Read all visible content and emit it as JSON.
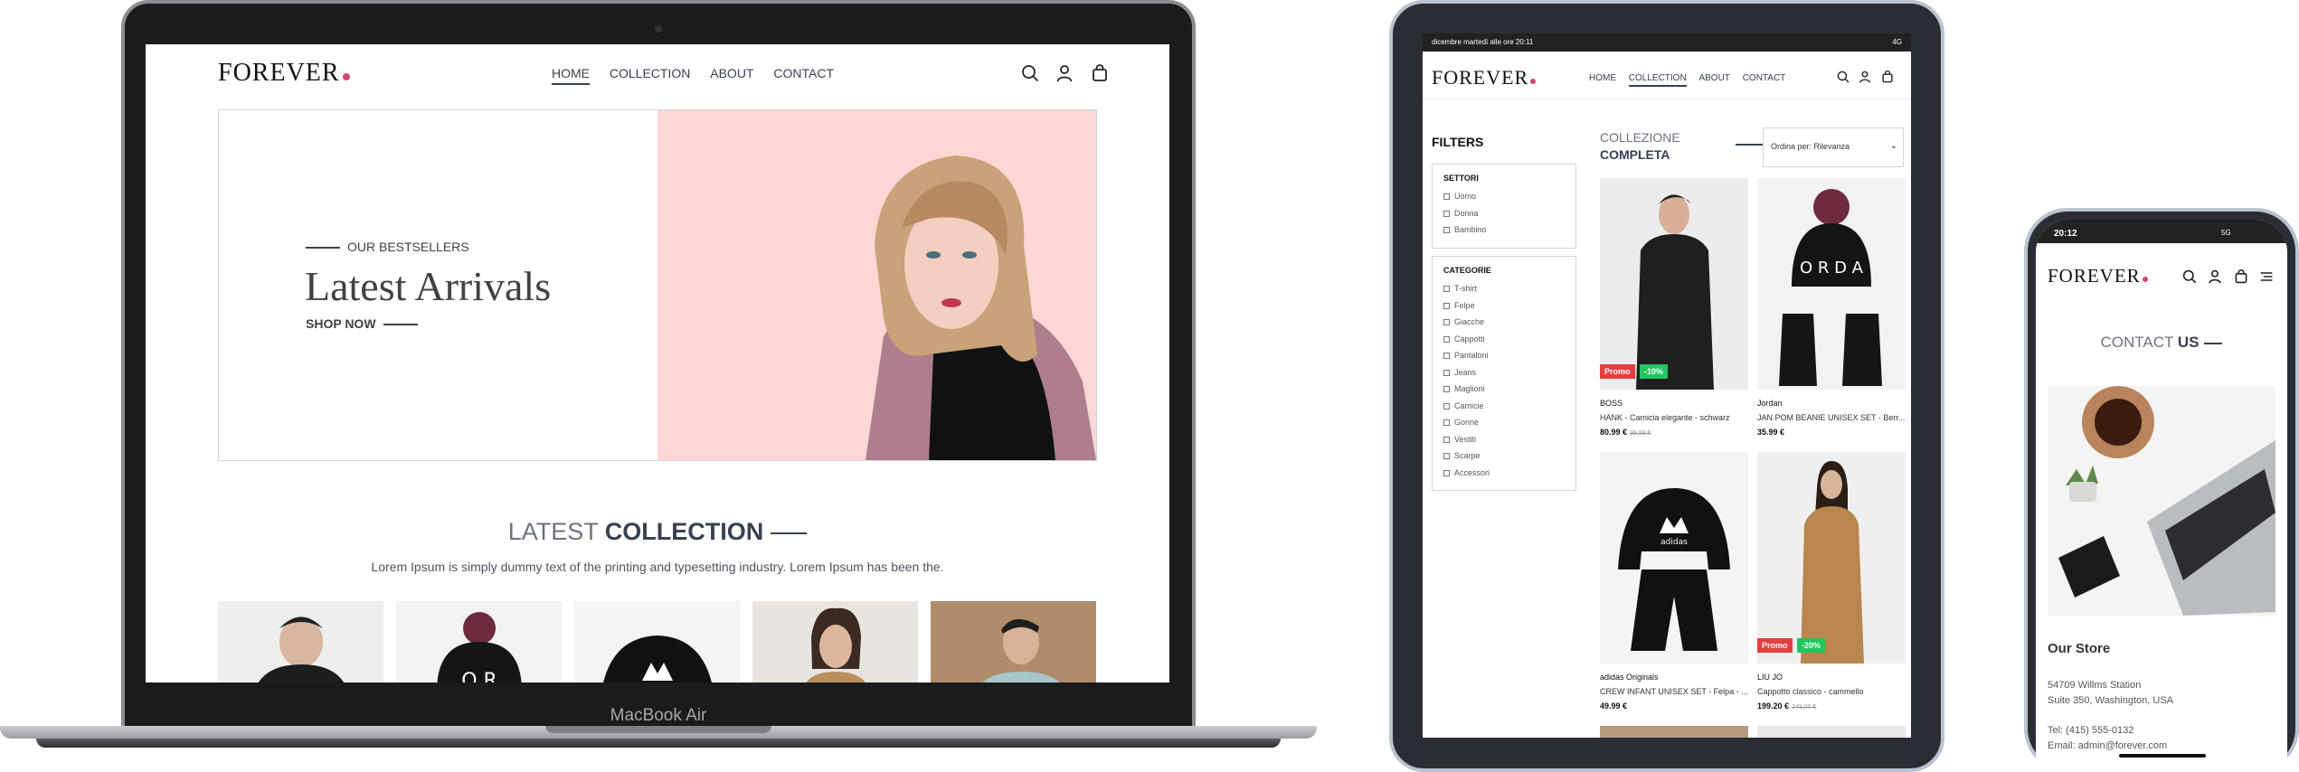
{
  "laptop": {
    "brand_label": "MacBook Air",
    "logo": "FOREVER",
    "nav": [
      "HOME",
      "COLLECTION",
      "ABOUT",
      "CONTACT"
    ],
    "icons": [
      "search-icon",
      "user-icon",
      "bag-icon"
    ],
    "hero": {
      "kicker": "OUR BESTSELLERS",
      "headline": "Latest Arrivals",
      "cta": "SHOP NOW"
    },
    "collection": {
      "title_light": "LATEST",
      "title_bold": "COLLECTION",
      "subtitle": "Lorem Ipsum is simply dummy text of the printing and typesetting industry. Lorem Ipsum has been the."
    }
  },
  "tablet": {
    "status_left": "dicembre martedì alle ore 20:11",
    "status_right": "4G",
    "logo": "FOREVER",
    "nav": [
      "HOME",
      "COLLECTION",
      "ABOUT",
      "CONTACT"
    ],
    "filters_title": "FILTERS",
    "settori": {
      "title": "SETTORI",
      "options": [
        "Uomo",
        "Donna",
        "Bambino"
      ]
    },
    "categorie": {
      "title": "CATEGORIE",
      "options": [
        "T-shirt",
        "Felpe",
        "Giacche",
        "Cappotti",
        "Pantaloni",
        "Jeans",
        "Maglioni",
        "Camicie",
        "Gonne",
        "Vestiti",
        "Scarpe",
        "Accessori"
      ]
    },
    "collection_title_light": "COLLEZIONE",
    "collection_title_bold": "COMPLETA",
    "sort_label": "Ordina per: Rilevanza",
    "products": [
      {
        "brand": "BOSS",
        "name": "HANK - Camicia elegante - schwarz",
        "price": "80.99 €",
        "old_price": "99,99 €",
        "badge_promo": "Promo",
        "badge_discount": "-10%"
      },
      {
        "brand": "Jordan",
        "name": "JAN POM BEANIE UNISEX SET - Berr...",
        "price": "35.99 €",
        "old_price": "",
        "badge_promo": "",
        "badge_discount": ""
      },
      {
        "brand": "adidas Originals",
        "name": "CREW INFANT UNISEX SET - Felpa - ...",
        "price": "49.99 €",
        "old_price": "",
        "badge_promo": "",
        "badge_discount": ""
      },
      {
        "brand": "LIU JO",
        "name": "Cappotto classico - cammello",
        "price": "199.20 €",
        "old_price": "249,00 €",
        "badge_promo": "Promo",
        "badge_discount": "-20%"
      }
    ]
  },
  "phone": {
    "time": "20:12",
    "signal": "5G",
    "logo": "FOREVER",
    "title_light": "CONTACT",
    "title_bold": "US",
    "store_title": "Our Store",
    "address_1": "54709 Willms Station",
    "address_2": "Suite 350, Washington, USA",
    "tel": "Tel: (415) 555-0132",
    "email": "Email: admin@forever.com"
  },
  "colors": {
    "brand_dot": "#d6476b",
    "hero_pink": "#fcd7d6",
    "badge_red": "#e53e3e",
    "badge_green": "#22c55e"
  }
}
